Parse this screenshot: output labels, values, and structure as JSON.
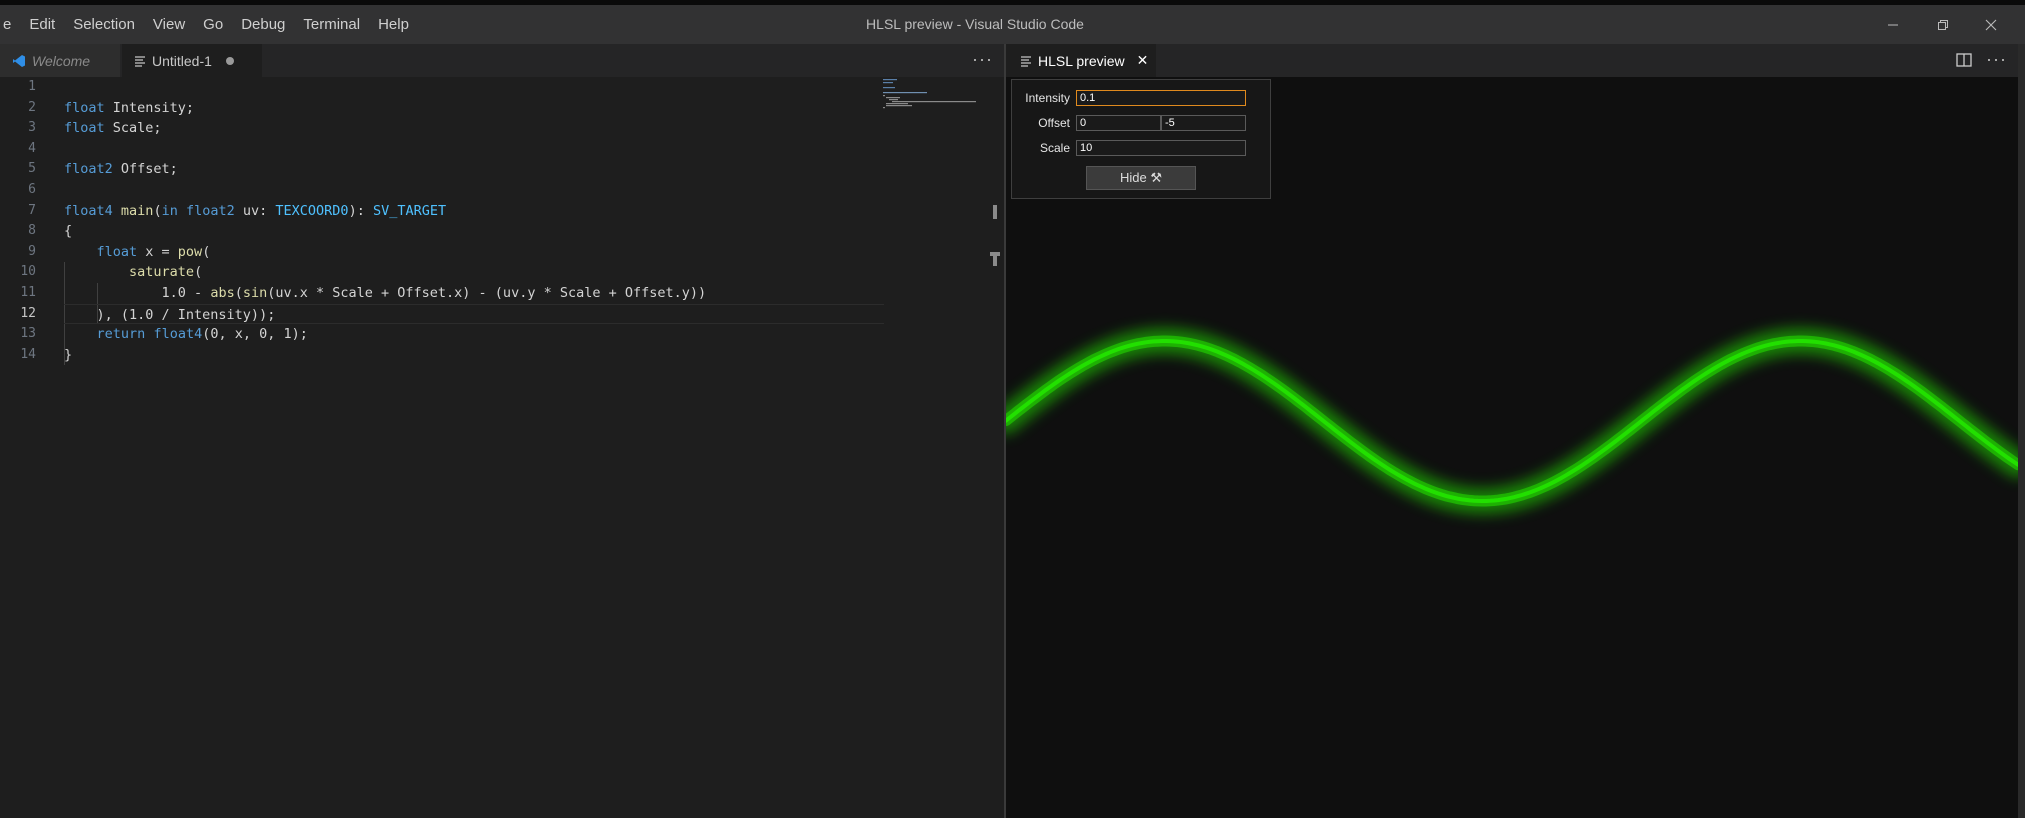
{
  "menu": [
    "e",
    "Edit",
    "Selection",
    "View",
    "Go",
    "Debug",
    "Terminal",
    "Help"
  ],
  "window_title": "HLSL preview - Visual Studio Code",
  "editor": {
    "tabs": [
      {
        "label": "Welcome",
        "icon": "vscode-logo-icon"
      },
      {
        "label": "Untitled-1",
        "icon": "file-lines-icon",
        "dirty": true
      }
    ],
    "more_label": "···",
    "current_line": 12,
    "lines": [
      {
        "n": "1",
        "text": ""
      },
      {
        "n": "2",
        "text": "float Intensity;"
      },
      {
        "n": "3",
        "text": "float Scale;"
      },
      {
        "n": "4",
        "text": ""
      },
      {
        "n": "5",
        "text": "float2 Offset;"
      },
      {
        "n": "6",
        "text": ""
      },
      {
        "n": "7",
        "text": "float4 main(in float2 uv: TEXCOORD0): SV_TARGET"
      },
      {
        "n": "8",
        "text": "{"
      },
      {
        "n": "9",
        "text": "    float x = pow("
      },
      {
        "n": "10",
        "text": "        saturate("
      },
      {
        "n": "11",
        "text": "            1.0 - abs(sin(uv.x * Scale + Offset.x) - (uv.y * Scale + Offset.y))"
      },
      {
        "n": "12",
        "text": "    ), (1.0 / Intensity));"
      },
      {
        "n": "13",
        "text": "    return float4(0, x, 0, 1);"
      },
      {
        "n": "14",
        "text": "}"
      }
    ]
  },
  "preview": {
    "tab_label": "HLSL preview",
    "close_glyph": "✕",
    "more_label": "···",
    "controls": {
      "intensity_label": "Intensity",
      "intensity_value": "0.1",
      "offset_label": "Offset",
      "offset_x": "0",
      "offset_y": "-5",
      "scale_label": "Scale",
      "scale_value": "10",
      "hide_label": "Hide ⚒"
    },
    "wave_color": "#22e000"
  },
  "colors": {
    "keyword": "#569cd6",
    "function": "#dcdcaa",
    "semantic": "#4fc1ff",
    "titlebar": "#323233",
    "editor_bg": "#1e1e1e",
    "focus_border": "#e08a1e"
  }
}
